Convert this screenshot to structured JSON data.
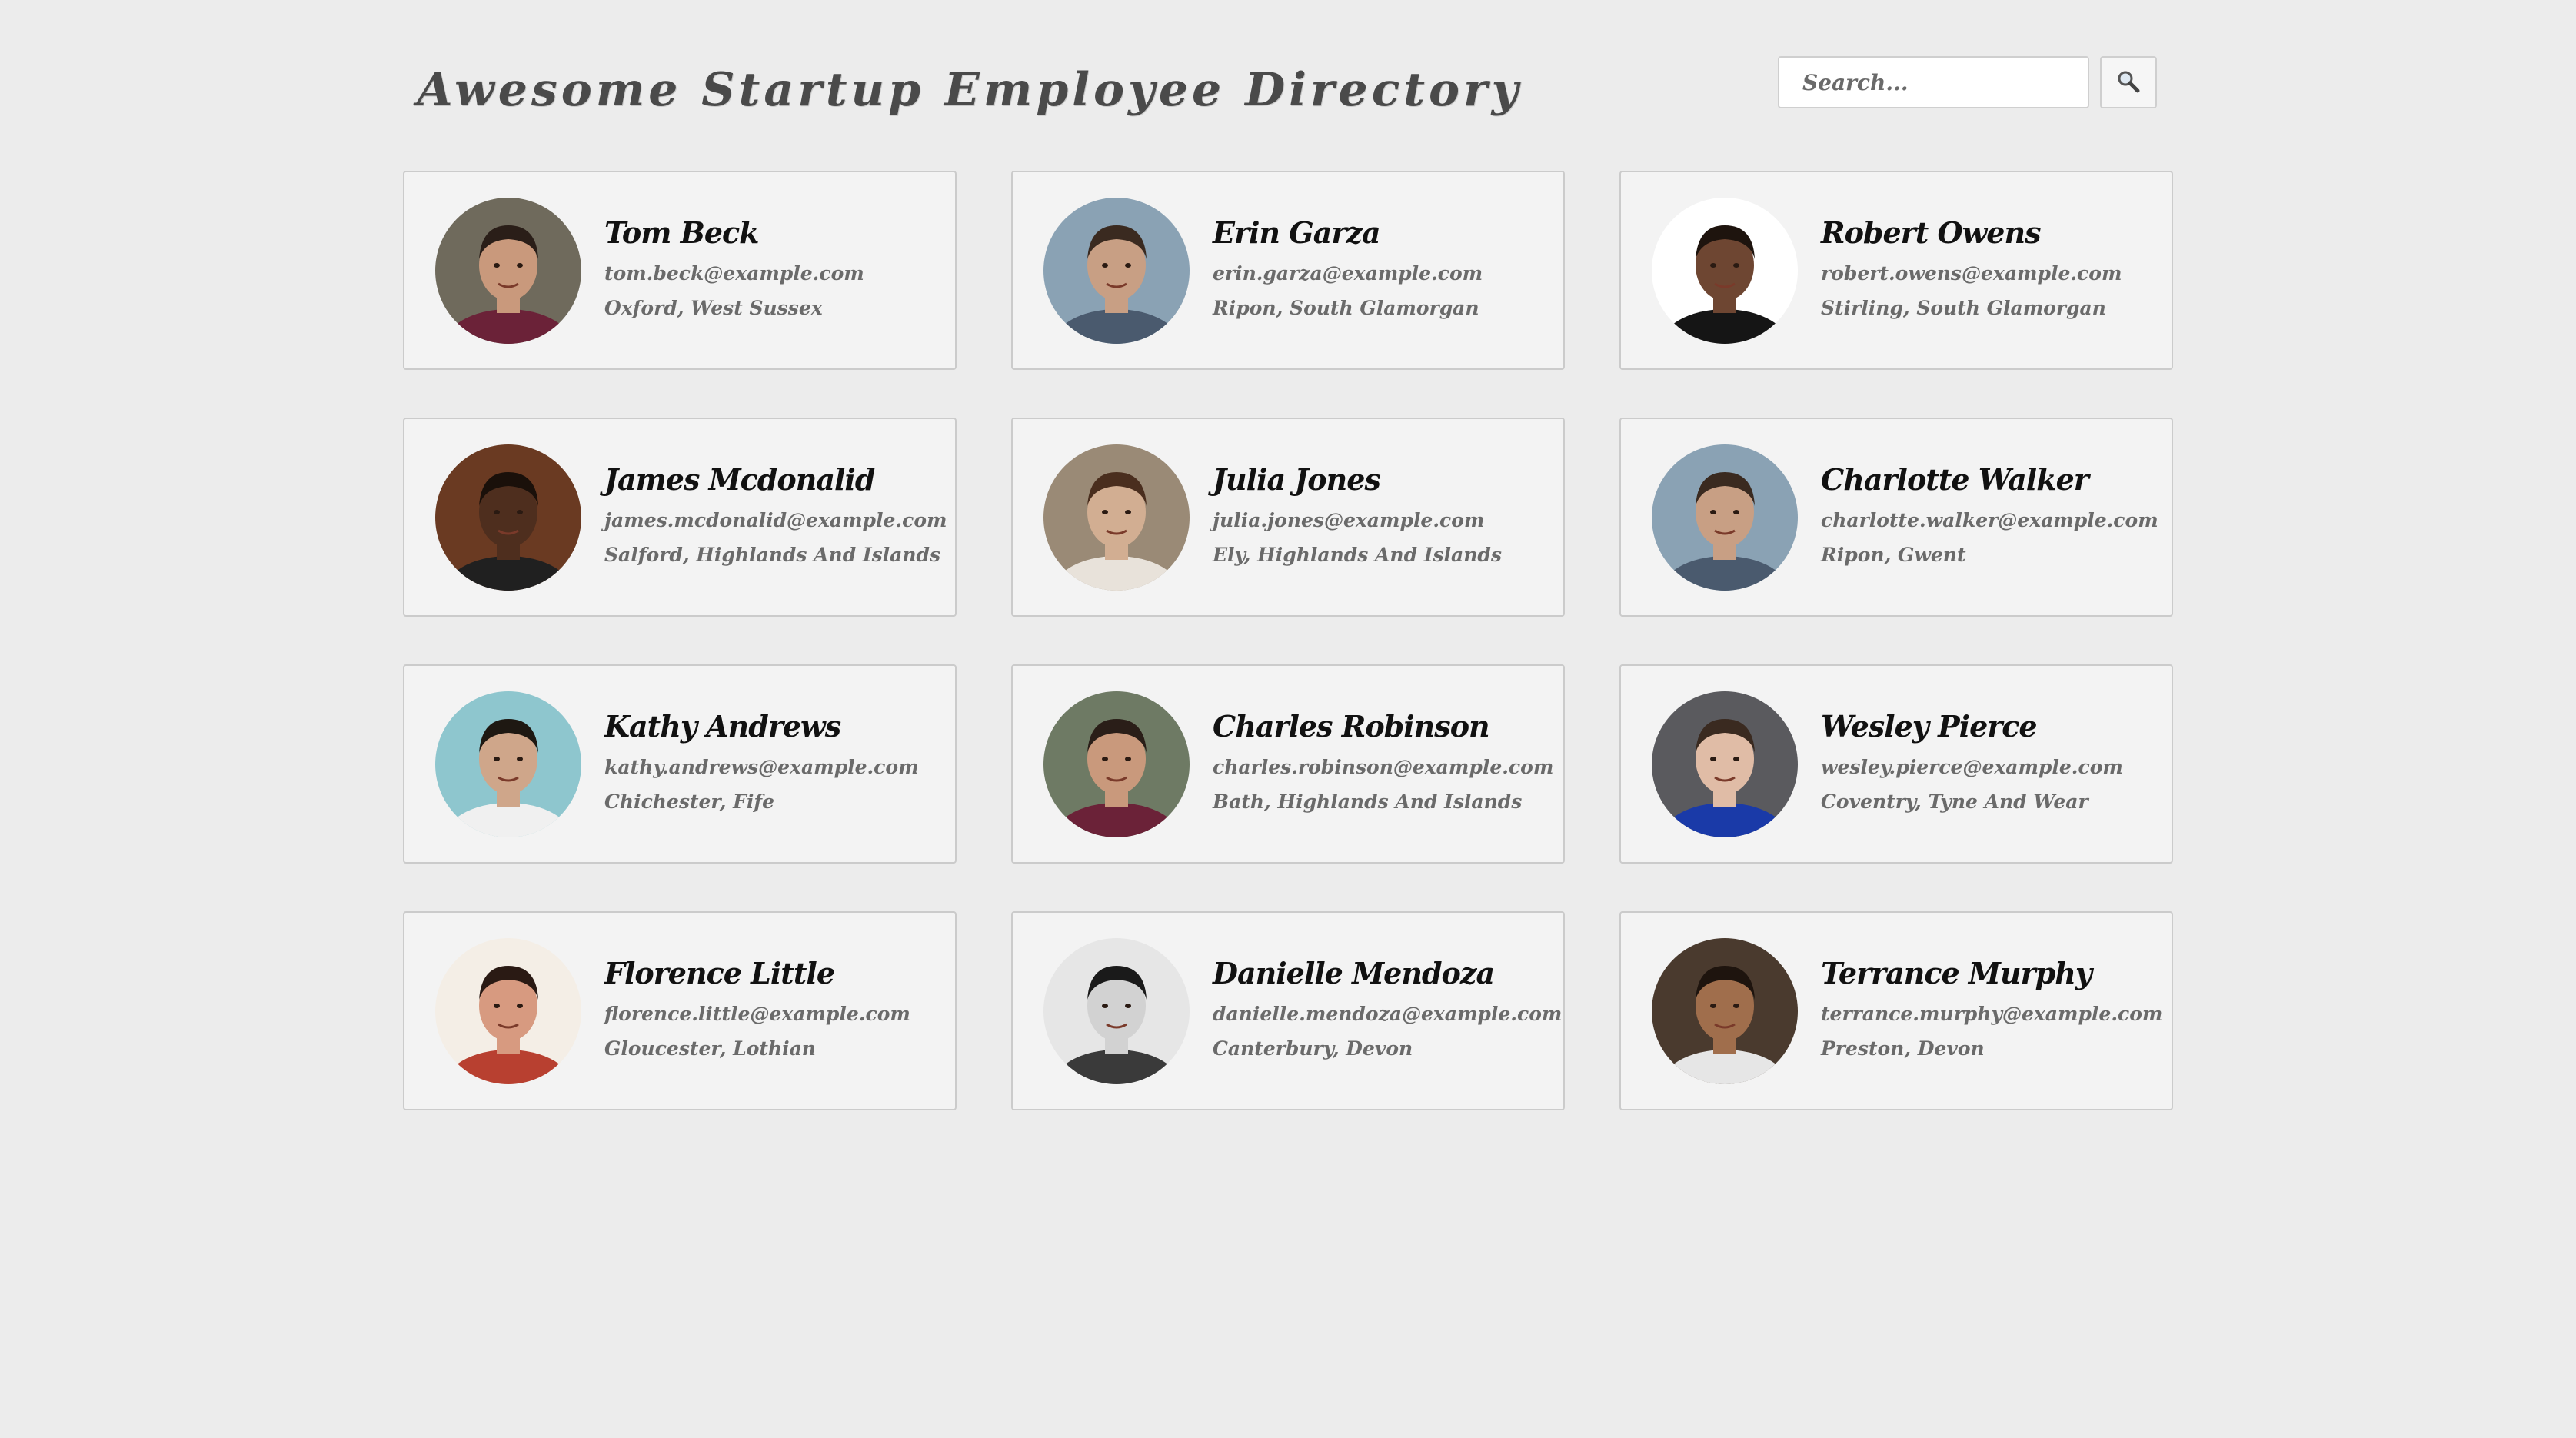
{
  "header": {
    "title": "Awesome Startup Employee Directory",
    "search": {
      "placeholder": "Search...",
      "value": "",
      "button_icon": "magnifier-icon"
    }
  },
  "employees": [
    {
      "name": "Tom Beck",
      "email": "tom.beck@example.com",
      "location": "Oxford, West Sussex",
      "bg": "#6f6a5c",
      "skin": "#c9997c",
      "hair": "#2a1e18",
      "shirt": "#6b2238"
    },
    {
      "name": "Erin Garza",
      "email": "erin.garza@example.com",
      "location": "Ripon, South Glamorgan",
      "bg": "#8aa2b4",
      "skin": "#c89f84",
      "hair": "#3a2a20",
      "shirt": "#4a5a6e"
    },
    {
      "name": "Robert Owens",
      "email": "robert.owens@example.com",
      "location": "Stirling, South Glamorgan",
      "bg": "#ffffff",
      "skin": "#6e4632",
      "hair": "#1e140e",
      "shirt": "#151515"
    },
    {
      "name": "James Mcdonalid",
      "email": "james.mcdonalid@example.com",
      "location": "Salford, Highlands And Islands",
      "bg": "#6a3a22",
      "skin": "#4e2e1e",
      "hair": "#1a100a",
      "shirt": "#202020"
    },
    {
      "name": "Julia Jones",
      "email": "julia.jones@example.com",
      "location": "Ely, Highlands And Islands",
      "bg": "#9a8a76",
      "skin": "#d2ae92",
      "hair": "#4a2e1e",
      "shirt": "#e8e2da"
    },
    {
      "name": "Charlotte Walker",
      "email": "charlotte.walker@example.com",
      "location": "Ripon, Gwent",
      "bg": "#8aa2b4",
      "skin": "#c89f84",
      "hair": "#3a2a20",
      "shirt": "#4a5a6e"
    },
    {
      "name": "Kathy Andrews",
      "email": "kathy.andrews@example.com",
      "location": "Chichester, Fife",
      "bg": "#8ec6ce",
      "skin": "#cfa68a",
      "hair": "#1e1812",
      "shirt": "#f0f0f0"
    },
    {
      "name": "Charles Robinson",
      "email": "charles.robinson@example.com",
      "location": "Bath, Highlands And Islands",
      "bg": "#6e7a64",
      "skin": "#c9997c",
      "hair": "#2a1e18",
      "shirt": "#6b2238"
    },
    {
      "name": "Wesley Pierce",
      "email": "wesley.pierce@example.com",
      "location": "Coventry, Tyne And Wear",
      "bg": "#5a5a5e",
      "skin": "#e0bca6",
      "hair": "#3a2a20",
      "shirt": "#1a3aa8"
    },
    {
      "name": "Florence Little",
      "email": "florence.little@example.com",
      "location": "Gloucester, Lothian",
      "bg": "#f4eee6",
      "skin": "#d79a80",
      "hair": "#2a1a14",
      "shirt": "#b84030"
    },
    {
      "name": "Danielle Mendoza",
      "email": "danielle.mendoza@example.com",
      "location": "Canterbury, Devon",
      "bg": "#e6e6e6",
      "skin": "#d2d2d2",
      "hair": "#1a1a1a",
      "shirt": "#3a3a3a"
    },
    {
      "name": "Terrance Murphy",
      "email": "terrance.murphy@example.com",
      "location": "Preston, Devon",
      "bg": "#4a3a2e",
      "skin": "#a06e4c",
      "hair": "#1e140e",
      "shirt": "#e6e6e6"
    }
  ]
}
